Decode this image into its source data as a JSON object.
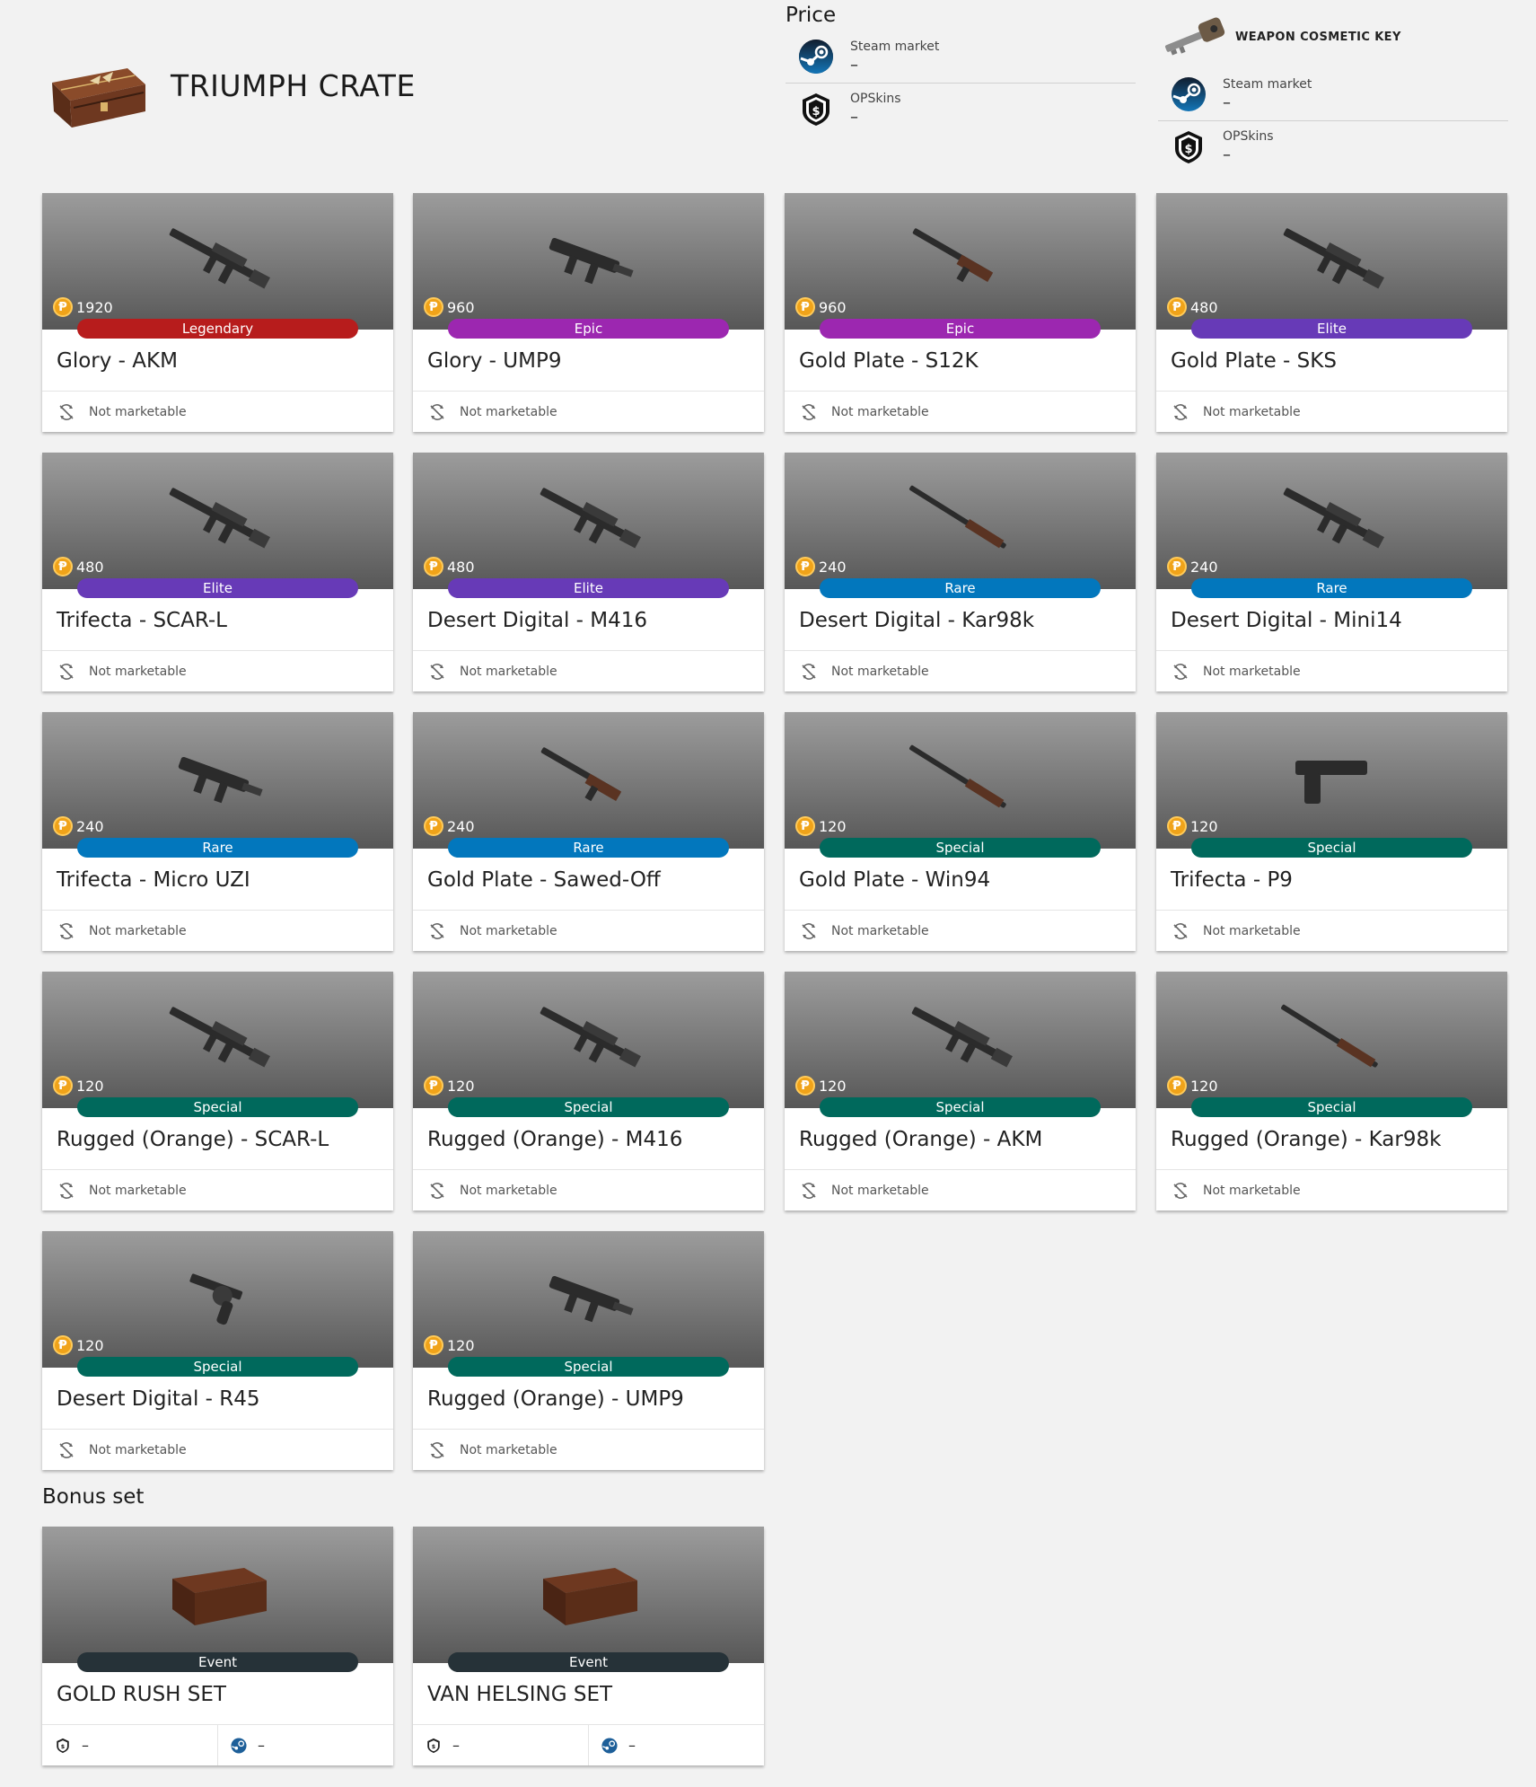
{
  "crate": {
    "title": "TRIUMPH CRATE",
    "image": "crate-icon"
  },
  "price": {
    "heading": "Price",
    "rows": [
      {
        "label": "Steam market",
        "value": "–",
        "icon": "steam-icon"
      },
      {
        "label": "OPSkins",
        "value": "–",
        "icon": "opskins-icon"
      }
    ]
  },
  "key": {
    "title": "WEAPON COSMETIC KEY",
    "image": "key-icon",
    "rows": [
      {
        "label": "Steam market",
        "value": "–",
        "icon": "steam-icon"
      },
      {
        "label": "OPSkins",
        "value": "–",
        "icon": "opskins-icon"
      }
    ]
  },
  "not_marketable_label": "Not marketable",
  "colors": {
    "Legendary": "#b71c1c",
    "Epic": "#9c27b0",
    "Elite": "#673ab7",
    "Rare": "#0277bd",
    "Special": "#00695c",
    "Event": "#263238",
    "coin": "#f0a319"
  },
  "items": [
    {
      "name": "Glory - AKM",
      "bp": "1920",
      "rarity": "Legendary",
      "icon": "rifle-icon"
    },
    {
      "name": "Glory - UMP9",
      "bp": "960",
      "rarity": "Epic",
      "icon": "smg-icon"
    },
    {
      "name": "Gold Plate - S12K",
      "bp": "960",
      "rarity": "Epic",
      "icon": "shotgun-icon"
    },
    {
      "name": "Gold Plate - SKS",
      "bp": "480",
      "rarity": "Elite",
      "icon": "rifle-icon"
    },
    {
      "name": "Trifecta - SCAR-L",
      "bp": "480",
      "rarity": "Elite",
      "icon": "rifle-icon"
    },
    {
      "name": "Desert Digital - M416",
      "bp": "480",
      "rarity": "Elite",
      "icon": "rifle-icon"
    },
    {
      "name": "Desert Digital - Kar98k",
      "bp": "240",
      "rarity": "Rare",
      "icon": "sniper-icon"
    },
    {
      "name": "Desert Digital - Mini14",
      "bp": "240",
      "rarity": "Rare",
      "icon": "rifle-icon"
    },
    {
      "name": "Trifecta - Micro UZI",
      "bp": "240",
      "rarity": "Rare",
      "icon": "smg-icon"
    },
    {
      "name": "Gold Plate - Sawed-Off",
      "bp": "240",
      "rarity": "Rare",
      "icon": "shotgun-icon"
    },
    {
      "name": "Gold Plate - Win94",
      "bp": "120",
      "rarity": "Special",
      "icon": "sniper-icon"
    },
    {
      "name": "Trifecta - P9",
      "bp": "120",
      "rarity": "Special",
      "icon": "pistol-icon"
    },
    {
      "name": "Rugged (Orange) - SCAR-L",
      "bp": "120",
      "rarity": "Special",
      "icon": "rifle-icon"
    },
    {
      "name": "Rugged (Orange) - M416",
      "bp": "120",
      "rarity": "Special",
      "icon": "rifle-icon"
    },
    {
      "name": "Rugged (Orange) - AKM",
      "bp": "120",
      "rarity": "Special",
      "icon": "rifle-icon"
    },
    {
      "name": "Rugged (Orange) - Kar98k",
      "bp": "120",
      "rarity": "Special",
      "icon": "sniper-icon"
    },
    {
      "name": "Desert Digital - R45",
      "bp": "120",
      "rarity": "Special",
      "icon": "revolver-icon"
    },
    {
      "name": "Rugged (Orange) - UMP9",
      "bp": "120",
      "rarity": "Special",
      "icon": "smg-icon"
    }
  ],
  "bonus": {
    "heading": "Bonus set",
    "items": [
      {
        "name": "GOLD RUSH SET",
        "rarity": "Event",
        "opskins": "–",
        "steam": "–",
        "icon": "box-icon"
      },
      {
        "name": "VAN HELSING SET",
        "rarity": "Event",
        "opskins": "–",
        "steam": "–",
        "icon": "box-icon"
      }
    ]
  }
}
